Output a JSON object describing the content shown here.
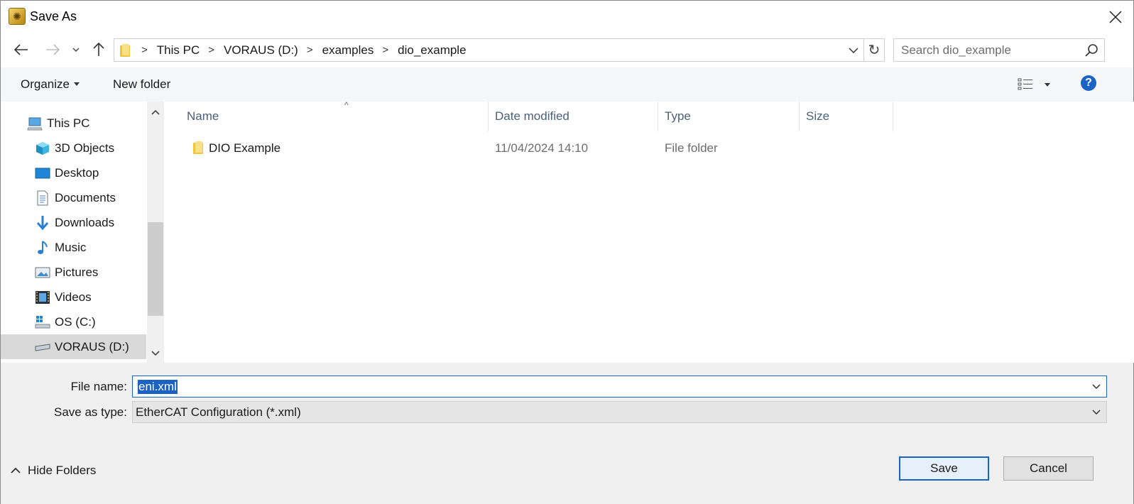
{
  "window": {
    "title": "Save As"
  },
  "address": {
    "crumbs": [
      "This PC",
      "VORAUS (D:)",
      "examples",
      "dio_example"
    ]
  },
  "search": {
    "placeholder": "Search dio_example"
  },
  "toolbar": {
    "organize_label": "Organize",
    "new_folder_label": "New folder",
    "help_label": "?"
  },
  "navpane": {
    "items": [
      {
        "label": "This PC",
        "icon": "computer-icon",
        "selected": false
      },
      {
        "label": "3D Objects",
        "icon": "cube-icon",
        "selected": false
      },
      {
        "label": "Desktop",
        "icon": "desktop-icon",
        "selected": false
      },
      {
        "label": "Documents",
        "icon": "document-icon",
        "selected": false
      },
      {
        "label": "Downloads",
        "icon": "download-arrow-icon",
        "selected": false
      },
      {
        "label": "Music",
        "icon": "music-note-icon",
        "selected": false
      },
      {
        "label": "Pictures",
        "icon": "picture-icon",
        "selected": false
      },
      {
        "label": "Videos",
        "icon": "film-icon",
        "selected": false
      },
      {
        "label": "OS (C:)",
        "icon": "windows-drive-icon",
        "selected": false
      },
      {
        "label": "VORAUS (D:)",
        "icon": "drive-icon",
        "selected": true
      }
    ]
  },
  "filelist": {
    "columns": [
      "Name",
      "Date modified",
      "Type",
      "Size"
    ],
    "rows": [
      {
        "name": "DIO Example",
        "date": "11/04/2024 14:10",
        "type": "File folder",
        "size": ""
      }
    ]
  },
  "form": {
    "file_name_label": "File name:",
    "file_name_value": "eni.xml",
    "save_type_label": "Save as type:",
    "save_type_value": "EtherCAT Configuration (*.xml)"
  },
  "footer": {
    "hide_folders_label": "Hide Folders",
    "save_label": "Save",
    "cancel_label": "Cancel"
  },
  "colors": {
    "accent": "#1a62c4",
    "folder": "#f0c53a",
    "selected_bg": "#d9d9d9"
  }
}
